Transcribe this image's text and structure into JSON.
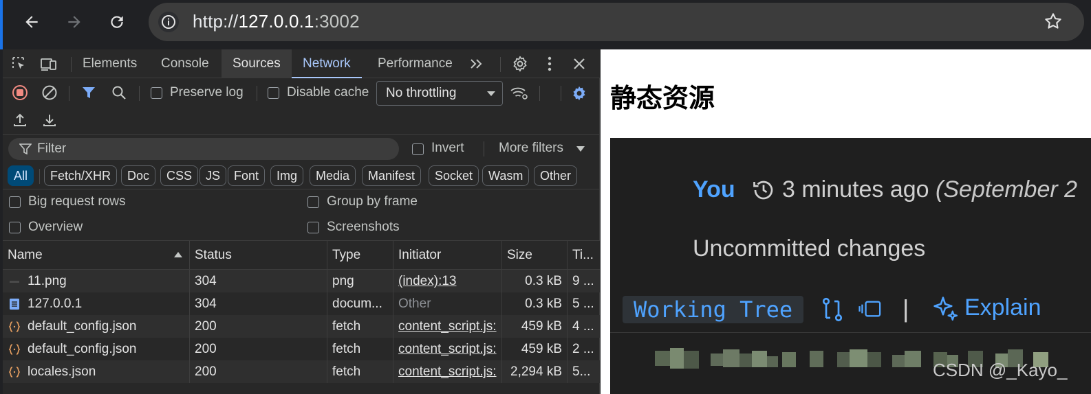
{
  "browser": {
    "url_scheme": "http://",
    "url_host": "127.0.0.1",
    "url_port": ":3002"
  },
  "devtools": {
    "tabs": [
      "Elements",
      "Console",
      "Sources",
      "Network",
      "Performance"
    ],
    "active_tab": "Network",
    "toolbar": {
      "preserve_log": "Preserve log",
      "disable_cache": "Disable cache",
      "throttling": "No throttling"
    },
    "filter": {
      "placeholder": "Filter",
      "invert": "Invert",
      "more_filters": "More filters"
    },
    "type_chips": [
      "All",
      "Fetch/XHR",
      "Doc",
      "CSS",
      "JS",
      "Font",
      "Img",
      "Media",
      "Manifest",
      "Socket",
      "Wasm",
      "Other"
    ],
    "options": {
      "big_request_rows": "Big request rows",
      "group_by_frame": "Group by frame",
      "overview": "Overview",
      "screenshots": "Screenshots"
    },
    "table": {
      "columns": [
        "Name",
        "Status",
        "Type",
        "Initiator",
        "Size",
        "Ti..."
      ],
      "rows": [
        {
          "name": "11.png",
          "status": "304",
          "type": "png",
          "initiator": "(index):13",
          "size": "0.3 kB",
          "time": "9 ...",
          "icon": "image-file-icon"
        },
        {
          "name": "127.0.0.1",
          "status": "304",
          "type": "docum...",
          "initiator": "Other",
          "size": "0.3 kB",
          "time": "5 ...",
          "icon": "document-file-icon"
        },
        {
          "name": "default_config.json",
          "status": "200",
          "type": "fetch",
          "initiator": "content_script.js:",
          "size": "459 kB",
          "time": "4 ...",
          "icon": "json-file-icon"
        },
        {
          "name": "default_config.json",
          "status": "200",
          "type": "fetch",
          "initiator": "content_script.js:",
          "size": "459 kB",
          "time": "2 ...",
          "icon": "json-file-icon"
        },
        {
          "name": "locales.json",
          "status": "200",
          "type": "fetch",
          "initiator": "content_script.js:",
          "size": "2,294 kB",
          "time": "5...",
          "icon": "json-file-icon"
        }
      ]
    }
  },
  "page": {
    "title": "静态资源",
    "image": {
      "author": "You",
      "time": "3 minutes ago",
      "time_detail": "(September 2",
      "message": "Uncommitted changes",
      "badge": "Working Tree",
      "explain": "Explain"
    },
    "watermark": "CSDN @_Kayo_"
  },
  "colors": {
    "accent": "#a8c7fa",
    "record": "#f28b82",
    "link_blue": "#4fa3ff",
    "chip_active": "#004a77"
  }
}
